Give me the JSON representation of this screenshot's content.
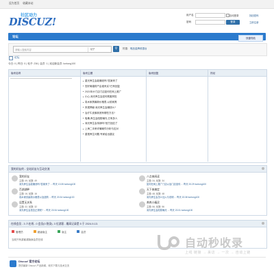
{
  "topbar": {
    "links": [
      "设为首页",
      "收藏本站"
    ]
  },
  "logo": {
    "cn": "社区动力",
    "en": "DISCUZ!"
  },
  "login": {
    "user_label": "用户名",
    "pass_label": "密码",
    "remember": "自动登录",
    "forgot": "找回密码",
    "register": "立即注册",
    "submit": "登录"
  },
  "nav": {
    "home": "论坛"
  },
  "quick_nav": "快捷导航",
  "search": {
    "placeholder": "请输入搜索内容",
    "scope": "帖子",
    "hot_label": "热搜:",
    "hot_terms": [
      "唯品金牌收银台"
    ]
  },
  "breadcrumb": "论坛",
  "stats": "今日: 0 | 昨日: 0 | 帖子: 236 | 会员: 1 | 欢迎新会员: luntong100",
  "board": {
    "columns": [
      "版块名称",
      "版块主题",
      "版块回复",
      "热帖"
    ]
  },
  "threads": [
    "重光养生会能赚钱吗?答案来了",
    "您好离婚财产由谁来买?已有回复",
    "2021年炒门店门店如何在网上推广",
    "小心,深光养生会如何规避风险",
    "真木家具最新价格表,以前家具",
    "央视揭秘:深光养生会赚钱么?",
    "治疗牛皮癣到底有哪些方法?",
    "吸毒,养生会陷阱曝光,已有多人",
    "深光养生会传销吗?官方回应了",
    "上海二手房诈骗案件分析与应对",
    "重视养生问题,专家给出建议"
  ],
  "friends": {
    "title": "我的好友的 - 全站好友与互动交流",
    "items": [
      {
        "name": "我的好友",
        "meta": "主题: 49, 帖数: 49",
        "last": "深光养生会能赚钱吗?答案来了 ... 昨天 13:35 luntong100"
      },
      {
        "name": "八点来阅读",
        "meta": "主题: 34, 帖数: 34",
        "last": "如何在网上推广门店以及门店宣传 ... 昨天 20:29 luntong100"
      },
      {
        "name": "百湖湖畔",
        "meta": "主题: 16, 帖数: 16",
        "last": "真木家具最新价格表以及选购 ... 昨天 20:34 luntong100"
      },
      {
        "name": "天下来搞定",
        "meta": "主题: 48, 帖数: 48",
        "last": "深光养生会怎么加入与说明 ... 昨天 20:38 luntong100"
      },
      {
        "name": "设置无关系",
        "meta": "主题: 32, 帖数: 32",
        "last": "深光养生会是否正规呢? ... 昨天 20:34 luntong100"
      },
      {
        "name": "养养小精灵",
        "meta": "主题: 56, 帖数: 56",
        "last": "深光养生会陷阱曝光 ... 昨天 20:31 luntong100"
      }
    ]
  },
  "online": {
    "title": "在线会员 - 3 人在线 - 0 会员(0 隐身), 3 位游客 - 最高记录是 5 于 2024-9-13.",
    "legend": [
      "管理员",
      "超级版主",
      "版主",
      "会员"
    ],
    "note": "当前只有游客或隐身会员在线"
  },
  "footer": {
    "title": "Discuz! 官方论坛",
    "sub": "提供最新 Discuz! 产品新闻、软件下载与技术交流"
  },
  "watermark": {
    "big": "自动秒收录",
    "small": "上线 链接 → 来访 → 一次 → 自动上链"
  },
  "colors": {
    "nav": "#2b7acd",
    "panel_head": "#e8eff5",
    "link": "#336699",
    "legend": [
      "#e54d4d",
      "#f0a030",
      "#3aa55a",
      "#3a7cc7"
    ]
  }
}
